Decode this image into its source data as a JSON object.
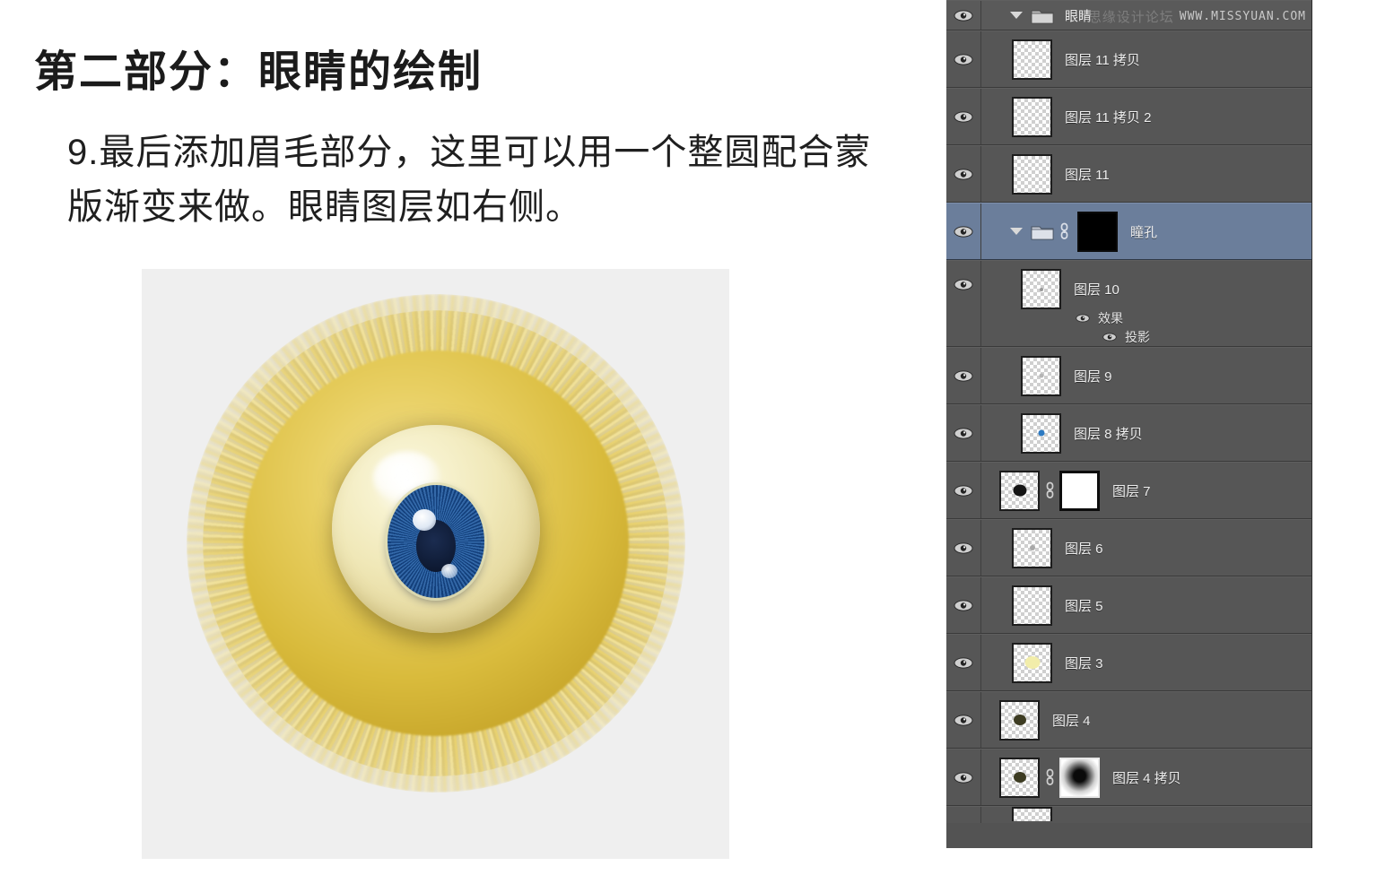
{
  "tutorial": {
    "title": "第二部分：眼睛的绘制",
    "body": "9.最后添加眉毛部分，这里可以用一个整圆配合蒙版渐变来做。眼睛图层如右侧。"
  },
  "watermark": {
    "cn": "思缘设计论坛",
    "en": "WWW.MISSYUAN.COM"
  },
  "artwork": {
    "name": "furry-eye-illustration",
    "background": "#efefef",
    "fur_color": "#d9bb3c",
    "eyeball_color": "#f0e8b8",
    "iris_color": "#1e5596",
    "pupil_color": "#101d38"
  },
  "panel": {
    "background": "#535353",
    "selected_color": "#6b7e9b",
    "rows": [
      {
        "type": "group-head",
        "label": "眼睛",
        "visible": true,
        "expanded": true,
        "selected": false
      },
      {
        "type": "layer",
        "label": "图层 11 拷贝",
        "visible": true,
        "selected": false,
        "thumb": "empty"
      },
      {
        "type": "layer",
        "label": "图层 11 拷贝 2",
        "visible": true,
        "selected": false,
        "thumb": "empty"
      },
      {
        "type": "layer",
        "label": "图层 11",
        "visible": true,
        "selected": false,
        "thumb": "empty"
      },
      {
        "type": "group-masked",
        "label": "瞳孔",
        "visible": true,
        "expanded": true,
        "selected": true,
        "linked": true,
        "mask": "black-dot"
      },
      {
        "type": "layer-fx",
        "label": "图层 10",
        "visible": true,
        "selected": false,
        "thumb": "tiny-dot",
        "effects": [
          {
            "label": "效果",
            "visible": true
          },
          {
            "label": "投影",
            "visible": true
          }
        ]
      },
      {
        "type": "layer",
        "label": "图层 9",
        "visible": true,
        "selected": false,
        "thumb": "faint-dot"
      },
      {
        "type": "layer",
        "label": "图层 8 拷贝",
        "visible": true,
        "selected": false,
        "thumb": "blue-dot"
      },
      {
        "type": "layer-masked",
        "label": "图层 7",
        "visible": true,
        "selected": false,
        "linked": true,
        "thumb": "black-dot",
        "mask": "white-blob"
      },
      {
        "type": "layer",
        "label": "图层 6",
        "visible": true,
        "selected": false,
        "thumb": "faint-dot"
      },
      {
        "type": "layer",
        "label": "图层 5",
        "visible": true,
        "selected": false,
        "thumb": "empty"
      },
      {
        "type": "layer",
        "label": "图层 3",
        "visible": true,
        "selected": false,
        "thumb": "yellow-blob"
      },
      {
        "type": "layer",
        "label": "图层 4",
        "visible": true,
        "selected": false,
        "thumb": "olive-dot"
      },
      {
        "type": "layer-masked",
        "label": "图层 4 拷贝",
        "visible": true,
        "selected": false,
        "linked": true,
        "thumb": "olive-dot",
        "mask": "radial-black"
      }
    ]
  }
}
